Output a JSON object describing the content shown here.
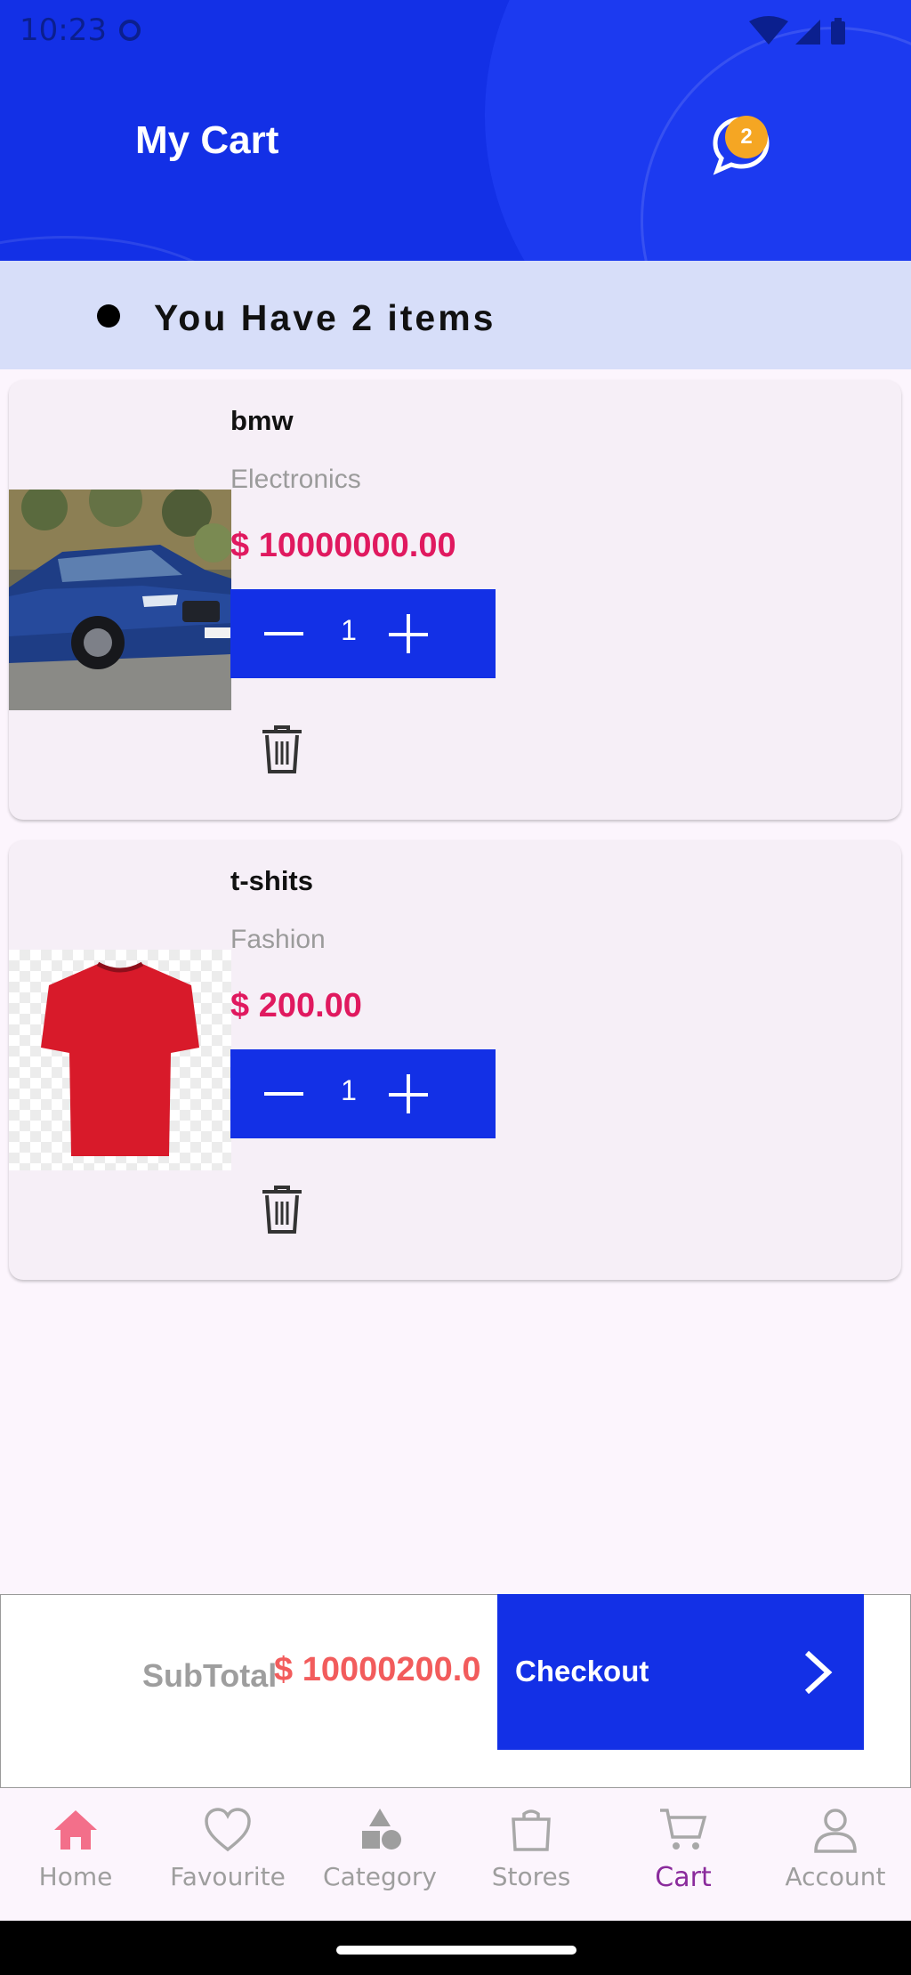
{
  "status_bar": {
    "time": "10:23"
  },
  "header": {
    "title": "My Cart",
    "chat_badge_count": "2"
  },
  "cart_summary": {
    "text": "You Have 2 items"
  },
  "cart_items": [
    {
      "name": "bmw",
      "category": "Electronics",
      "price": "$ 10000000.00",
      "quantity": "1",
      "image": "blue-car-image"
    },
    {
      "name": "t-shits",
      "category": "Fashion",
      "price": "$ 200.00",
      "quantity": "1",
      "image": "red-tshirt-image"
    }
  ],
  "checkout": {
    "subtotal_label": "SubTotal",
    "subtotal_value": "$ 10000200.0",
    "button_label": "Checkout"
  },
  "bottom_nav": {
    "items": [
      {
        "label": "Home",
        "icon": "home-icon"
      },
      {
        "label": "Favourite",
        "icon": "heart-icon"
      },
      {
        "label": "Category",
        "icon": "category-icon"
      },
      {
        "label": "Stores",
        "icon": "store-bag-icon"
      },
      {
        "label": "Cart",
        "icon": "cart-icon",
        "active": true
      },
      {
        "label": "Account",
        "icon": "account-icon"
      }
    ]
  },
  "colors": {
    "primary": "#1330e6",
    "price": "#e0195f",
    "subtotal": "#f25c5c",
    "badge": "#f5a623",
    "banner": "#d7def9",
    "nav_active": "#8a2b9c",
    "home_icon": "#f36f8a"
  }
}
